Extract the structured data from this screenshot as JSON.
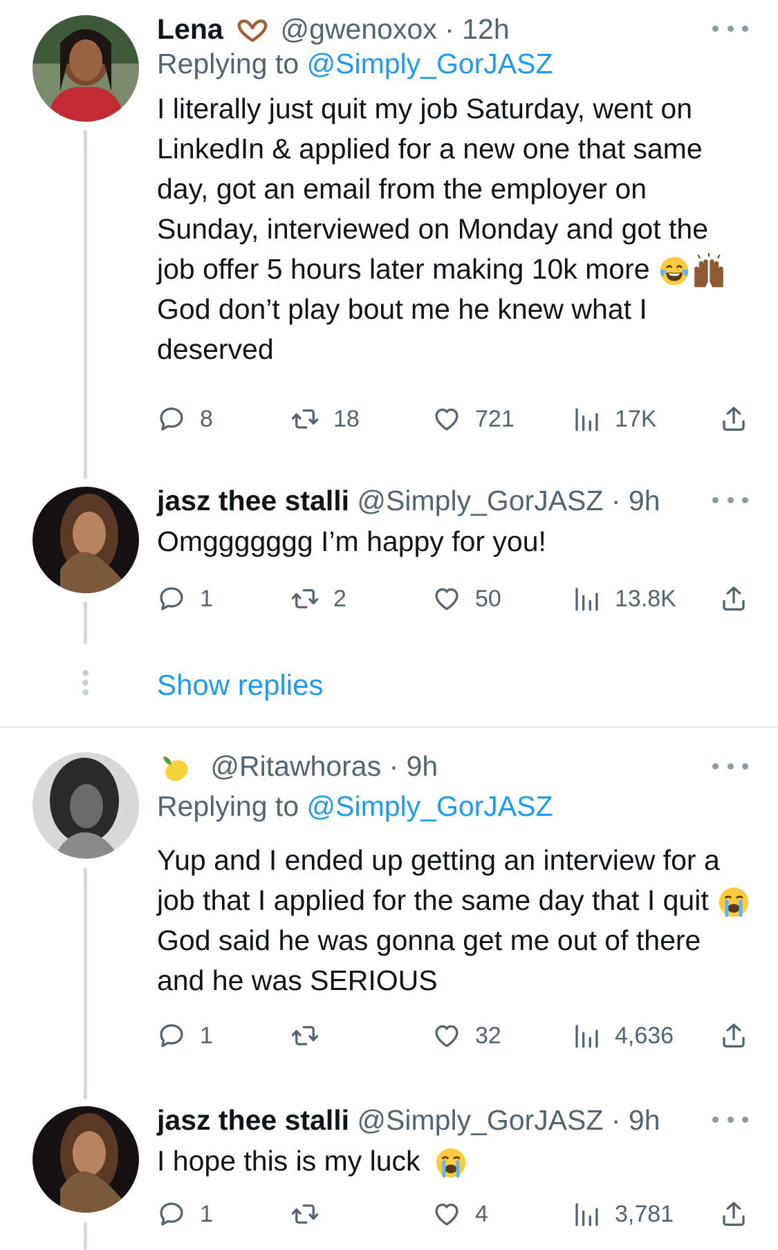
{
  "tweets": [
    {
      "name": "Lena",
      "handle": "@gwenoxox",
      "separator": "·",
      "time": "12h",
      "reply_prefix": "Replying to ",
      "reply_to": "@Simply_GorJASZ",
      "text_before": "I literally just quit my job Saturday, went on LinkedIn & applied for a new one that same day, got an email from the employer on Sunday, interviewed on Monday and got the job offer 5 hours later making 10k more",
      "text_after": "God don’t play bout me he knew what I deserved",
      "replies": "8",
      "retweets": "18",
      "likes": "721",
      "views": "17K"
    },
    {
      "name": "jasz thee stalli",
      "handle": "@Simply_GorJASZ",
      "separator": "·",
      "time": "9h",
      "text": "Omggggggg I’m happy for you!",
      "replies": "1",
      "retweets": "2",
      "likes": "50",
      "views": "13.8K"
    },
    {
      "handle": "@Ritawhoras",
      "separator": "·",
      "time": "9h",
      "reply_prefix": "Replying to ",
      "reply_to": "@Simply_GorJASZ",
      "text_before": "Yup and I ended up getting an interview for a job that I applied for the same day that I quit",
      "text_after": "God said he was gonna get me out of there and he was SERIOUS",
      "replies": "1",
      "retweets": "",
      "likes": "32",
      "views": "4,636"
    },
    {
      "name": "jasz thee stalli",
      "handle": "@Simply_GorJASZ",
      "separator": "·",
      "time": "9h",
      "text": "I hope this is my luck",
      "replies": "1",
      "retweets": "",
      "likes": "4",
      "views": "3,781"
    }
  ],
  "show_replies": "Show replies",
  "colors": {
    "link": "#1d9bf0",
    "muted": "#536471",
    "text": "#0f1419",
    "line": "#cfd9de"
  },
  "icons": [
    "reply-icon",
    "retweet-icon",
    "like-icon",
    "views-icon",
    "share-icon",
    "more-icon",
    "heart-hands-emoji",
    "joy-emoji",
    "raised-hands-emoji",
    "crying-emoji",
    "lemon-emoji"
  ]
}
